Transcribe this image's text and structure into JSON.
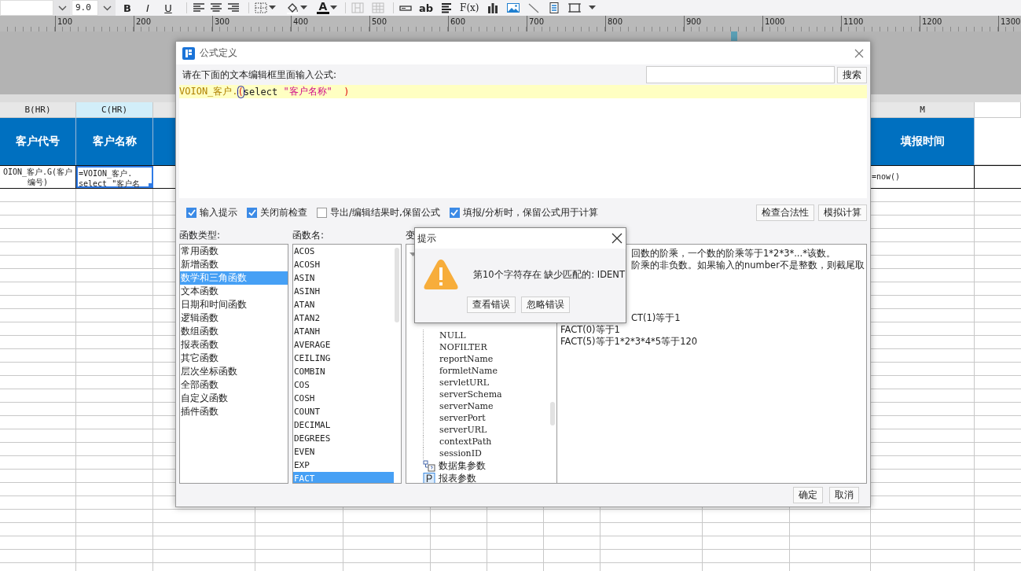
{
  "toolbar": {
    "font_size": "9.0",
    "style_buttons": [
      "B",
      "I",
      "U"
    ],
    "color_button": "A",
    "text_tools": [
      "ab",
      "F(x)"
    ]
  },
  "ruler": [
    "100",
    "200",
    "300",
    "400",
    "500",
    "600",
    "700",
    "800",
    "900",
    "1000",
    "1100",
    "1200",
    "1300"
  ],
  "sheet": {
    "columns": [
      {
        "header": "B(HR)",
        "selected": false,
        "title": "客户代号",
        "value": [
          "OION_客户.G(客户",
          "编号)"
        ]
      },
      {
        "header": "C(HR)",
        "selected": true,
        "title": "客户名称",
        "value": [
          "=VOION_客户.",
          "select \"客户名"
        ]
      },
      {
        "header": "M",
        "selected": false,
        "title": "填报时间",
        "value": [
          "=now()"
        ]
      }
    ]
  },
  "formula_dialog": {
    "title": "公式定义",
    "prompt": "请在下面的文本编辑框里面输入公式:",
    "search_button": "搜索",
    "formula": [
      {
        "kind": "name",
        "text": "VOION_客户.",
        "cursor": false
      },
      {
        "kind": "paren",
        "text": "(",
        "cursor": true
      },
      {
        "kind": "keyword",
        "text": "select ",
        "cursor": false
      },
      {
        "kind": "string",
        "text": "\"客户名称\"  ",
        "cursor": false
      },
      {
        "kind": "paren",
        "text": ")",
        "cursor": false
      }
    ],
    "options": [
      {
        "label": "输入提示",
        "checked": true
      },
      {
        "label": "关闭前检查",
        "checked": true
      },
      {
        "label": "导出/编辑结果时,保留公式",
        "checked": false
      },
      {
        "label": "填报/分析时，保留公式用于计算",
        "checked": true
      }
    ],
    "actions": [
      "检查合法性",
      "模拟计算"
    ],
    "function_types": {
      "label": "函数类型:",
      "items": [
        {
          "label": "常用函数",
          "selected": false
        },
        {
          "label": "新增函数",
          "selected": false
        },
        {
          "label": "数学和三角函数",
          "selected": true
        },
        {
          "label": "文本函数",
          "selected": false
        },
        {
          "label": "日期和时间函数",
          "selected": false
        },
        {
          "label": "逻辑函数",
          "selected": false
        },
        {
          "label": "数组函数",
          "selected": false
        },
        {
          "label": "报表函数",
          "selected": false
        },
        {
          "label": "其它函数",
          "selected": false
        },
        {
          "label": "层次坐标函数",
          "selected": false
        },
        {
          "label": "全部函数",
          "selected": false
        },
        {
          "label": "自定义函数",
          "selected": false
        },
        {
          "label": "插件函数",
          "selected": false
        }
      ]
    },
    "function_names": {
      "label": "函数名:",
      "items": [
        {
          "label": "ACOS",
          "selected": false
        },
        {
          "label": "ACOSH",
          "selected": false
        },
        {
          "label": "ASIN",
          "selected": false
        },
        {
          "label": "ASINH",
          "selected": false
        },
        {
          "label": "ATAN",
          "selected": false
        },
        {
          "label": "ATAN2",
          "selected": false
        },
        {
          "label": "ATANH",
          "selected": false
        },
        {
          "label": "AVERAGE",
          "selected": false
        },
        {
          "label": "CEILING",
          "selected": false
        },
        {
          "label": "COMBIN",
          "selected": false
        },
        {
          "label": "COS",
          "selected": false
        },
        {
          "label": "COSH",
          "selected": false
        },
        {
          "label": "COUNT",
          "selected": false
        },
        {
          "label": "DECIMAL",
          "selected": false
        },
        {
          "label": "DEGREES",
          "selected": false
        },
        {
          "label": "EVEN",
          "selected": false
        },
        {
          "label": "EXP",
          "selected": false
        },
        {
          "label": "FACT",
          "selected": true
        }
      ]
    },
    "variables": {
      "label": "变",
      "tree": [
        {
          "kind": "group",
          "children": [
            {
              "label": "NULL"
            },
            {
              "label": "NOFILTER"
            },
            {
              "label": "reportName"
            },
            {
              "label": "formletName"
            },
            {
              "label": "servletURL"
            },
            {
              "label": "serverSchema"
            },
            {
              "label": "serverName"
            },
            {
              "label": "serverPort"
            },
            {
              "label": "serverURL"
            },
            {
              "label": "contextPath"
            },
            {
              "label": "sessionID"
            }
          ]
        },
        {
          "kind": "dataset",
          "label": "数据集参数"
        },
        {
          "kind": "report",
          "label": "报表参数"
        }
      ]
    },
    "description": [
      {
        "kind": "cut",
        "text": "回数的阶乘，一个数的阶乘等于1*2*3*...*该数。"
      },
      {
        "kind": "cut",
        "text": "阶乘的非负数。如果输入的number不是整数，则截尾取"
      },
      {
        "kind": "cut-spaced",
        "text": "CT(1)等于1"
      },
      {
        "kind": "full",
        "text": "FACT(0)等于1"
      },
      {
        "kind": "full",
        "text": "FACT(5)等于1*2*3*4*5等于120"
      }
    ],
    "buttons": [
      "确定",
      "取消"
    ]
  },
  "alert": {
    "title": "提示",
    "message": "第10个字符存在 缺少匹配的: IDENT",
    "buttons": [
      "查看错误",
      "忽略错误"
    ]
  }
}
